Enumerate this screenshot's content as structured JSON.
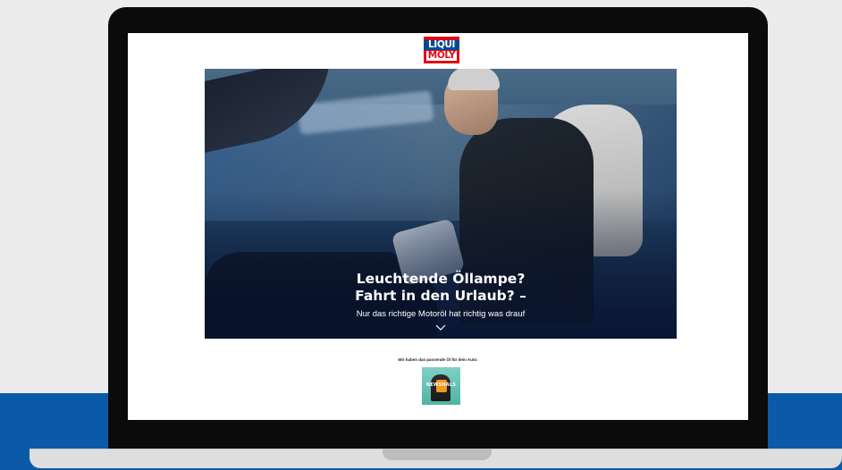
{
  "brand": {
    "logo_line1": "LIQUI",
    "logo_line2": "MOLY",
    "colors": {
      "red": "#e30613",
      "blue": "#004a93",
      "band_blue": "#0b5aa8"
    }
  },
  "hero": {
    "title_line1": "Leuchtende Öllampe?",
    "title_line2": "Fahrt in den Urlaub? –",
    "subtitle": "Nur das richtige Motoröl hat richtig was drauf",
    "scroll_icon": "chevron-down-icon"
  },
  "oil_finder": {
    "caption": "Wir haben das passende Öl für dein Auto:",
    "thumbnail_text": "NEWSHALS"
  }
}
